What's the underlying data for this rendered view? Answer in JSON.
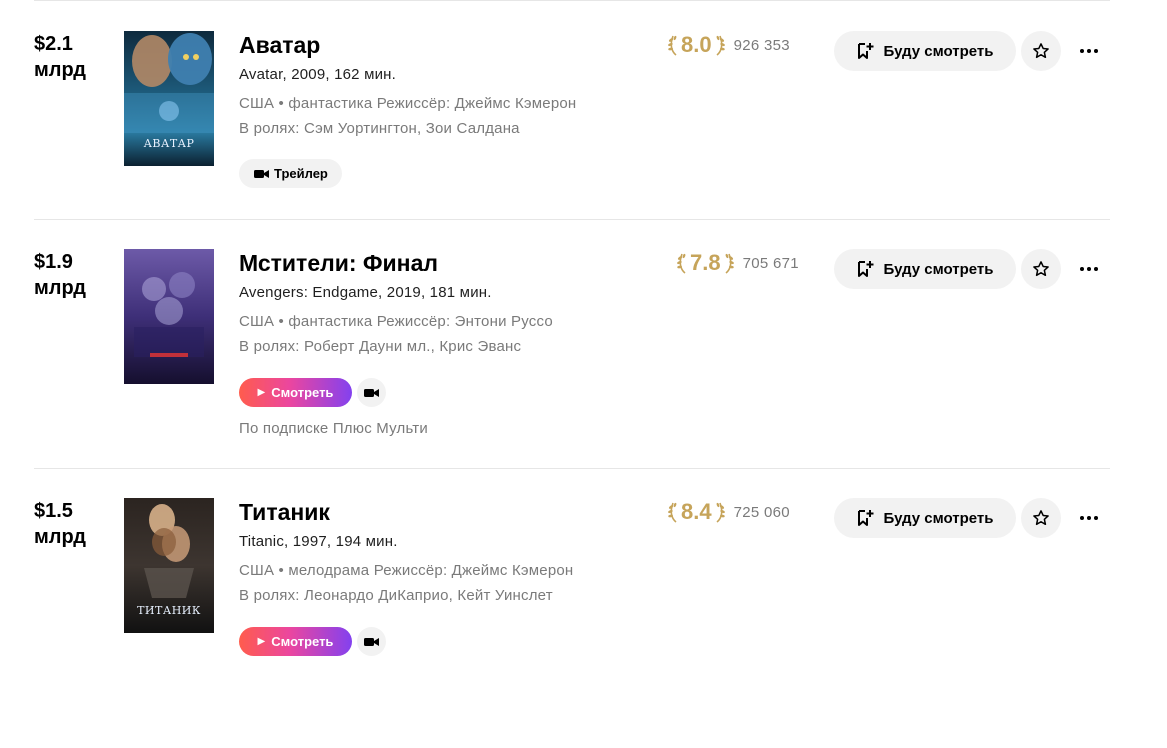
{
  "actions": {
    "watchlist_label": "Буду смотреть",
    "trailer_label": "Трейлер",
    "watch_label": "Смотреть"
  },
  "colors": {
    "rating_gold": "#c6a45a",
    "watch_gradient": [
      "#ff5c4d",
      "#eb469f",
      "#8341ef"
    ]
  },
  "movies": [
    {
      "box_office_amount": "$2.1",
      "box_office_unit": "млрд",
      "title": "Аватар",
      "original": "Avatar, 2009, 162 мин.",
      "meta": "США • фантастика  Режиссёр: Джеймс Кэмерон",
      "cast": "В ролях: Сэм Уортингтон, Зои Салдана",
      "rating": "8.0",
      "votes": "926 353",
      "poster_text": "АВАТАР"
    },
    {
      "box_office_amount": "$1.9",
      "box_office_unit": "млрд",
      "title": "Мстители: Финал",
      "original": "Avengers: Endgame, 2019, 181 мин.",
      "meta": "США • фантастика  Режиссёр: Энтони Руссо",
      "cast": "В ролях: Роберт Дауни мл., Крис Эванс",
      "rating": "7.8",
      "votes": "705 671",
      "subscription": "По подписке Плюс Мульти"
    },
    {
      "box_office_amount": "$1.5",
      "box_office_unit": "млрд",
      "title": "Титаник",
      "original": "Titanic, 1997, 194 мин.",
      "meta": "США • мелодрама  Режиссёр: Джеймс Кэмерон",
      "cast": "В ролях: Леонардо ДиКаприо, Кейт Уинслет",
      "rating": "8.4",
      "votes": "725 060",
      "poster_text": "ТИТАНИК"
    }
  ]
}
